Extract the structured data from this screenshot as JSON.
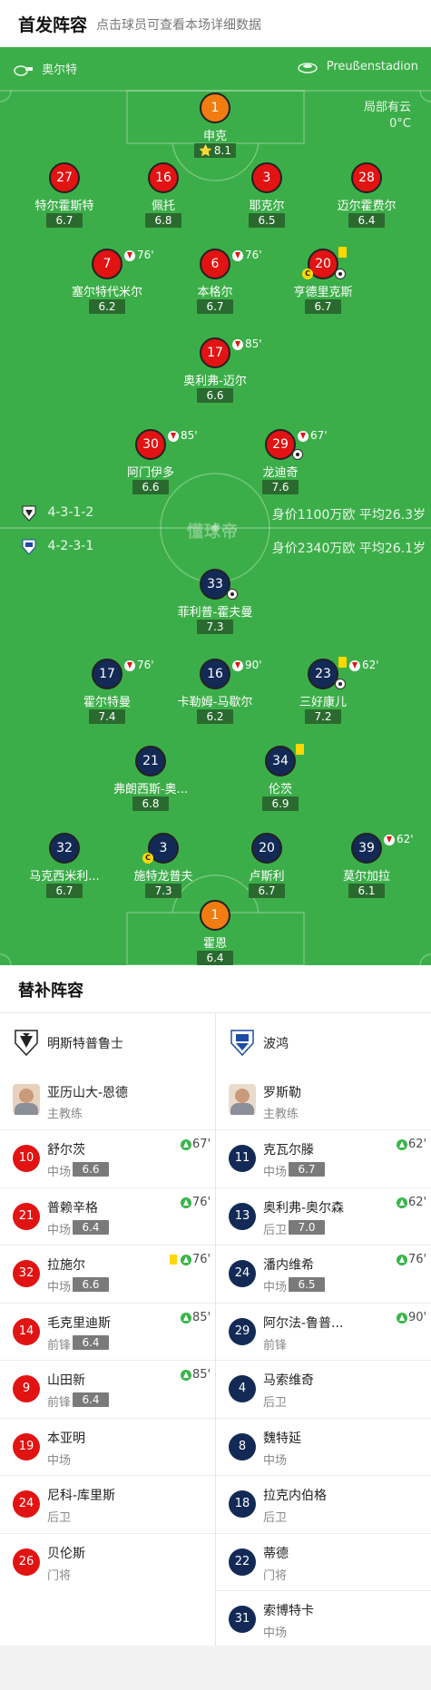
{
  "header": {
    "title": "首发阵容",
    "subtitle": "点击球员可查看本场详细数据"
  },
  "field": {
    "home_team": "奥尔特",
    "stadium": "Preußenstadion",
    "weather_line1": "局部有云",
    "weather_line2": "0°C",
    "home_formation": "4-3-1-2",
    "home_value": "身价1100万欧  平均26.3岁",
    "away_formation": "4-2-3-1",
    "away_value": "身价2340万欧  平均26.1岁",
    "watermark": "懂球帝",
    "home_players": [
      {
        "num": "1",
        "name": "申克",
        "rating": "8.1",
        "star": "⭐"
      },
      {
        "num": "27",
        "name": "特尔霍斯特",
        "rating": "6.7"
      },
      {
        "num": "16",
        "name": "佩托",
        "rating": "6.8"
      },
      {
        "num": "3",
        "name": "耶克尔",
        "rating": "6.5"
      },
      {
        "num": "28",
        "name": "迈尔霍费尔",
        "rating": "6.4"
      },
      {
        "num": "7",
        "name": "塞尔特代米尔",
        "rating": "6.2",
        "sub": "76'"
      },
      {
        "num": "6",
        "name": "本格尔",
        "rating": "6.7",
        "sub": "76'"
      },
      {
        "num": "20",
        "name": "亨德里克斯",
        "rating": "6.7",
        "cap": "C"
      },
      {
        "num": "17",
        "name": "奥利弗-迈尔",
        "rating": "6.6",
        "sub": "85'"
      },
      {
        "num": "30",
        "name": "阿门伊多",
        "rating": "6.6",
        "sub": "85'"
      },
      {
        "num": "29",
        "name": "龙迪奇",
        "rating": "7.6",
        "sub": "67'"
      }
    ],
    "away_players": [
      {
        "num": "33",
        "name": "菲利普-霍夫曼",
        "rating": "7.3"
      },
      {
        "num": "17",
        "name": "霍尔特曼",
        "rating": "7.4",
        "sub": "76'"
      },
      {
        "num": "16",
        "name": "卡勒姆-马歇尔",
        "rating": "6.2",
        "sub": "90'"
      },
      {
        "num": "23",
        "name": "三好康儿",
        "rating": "7.2",
        "sub": "62'"
      },
      {
        "num": "21",
        "name": "弗朗西斯-奥...",
        "rating": "6.8"
      },
      {
        "num": "34",
        "name": "伦茨",
        "rating": "6.9"
      },
      {
        "num": "32",
        "name": "马克西米利...",
        "rating": "6.7"
      },
      {
        "num": "3",
        "name": "施特龙普夫",
        "rating": "7.3",
        "cap": "C"
      },
      {
        "num": "20",
        "name": "卢斯利",
        "rating": "6.7"
      },
      {
        "num": "39",
        "name": "莫尔加拉",
        "rating": "6.1",
        "sub": "62'"
      },
      {
        "num": "1",
        "name": "霍恩",
        "rating": "6.4"
      }
    ]
  },
  "subs": {
    "title": "替补阵容",
    "home": {
      "club": "明斯特普鲁士",
      "coach": "亚历山大-恩德",
      "coach_role": "主教练",
      "players": [
        {
          "num": "10",
          "name": "舒尔茨",
          "pos": "中场",
          "rating": "6.6",
          "in": "67'"
        },
        {
          "num": "21",
          "name": "普赖辛格",
          "pos": "中场",
          "rating": "6.4",
          "in": "76'"
        },
        {
          "num": "32",
          "name": "拉施尔",
          "pos": "中场",
          "rating": "6.6",
          "in": "76'",
          "card": "yellow"
        },
        {
          "num": "14",
          "name": "毛克里迪斯",
          "pos": "前锋",
          "rating": "6.4",
          "in": "85'"
        },
        {
          "num": "9",
          "name": "山田新",
          "pos": "前锋",
          "rating": "6.4",
          "in": "85'"
        },
        {
          "num": "19",
          "name": "本亚明",
          "pos": "中场"
        },
        {
          "num": "24",
          "name": "尼科-库里斯",
          "pos": "后卫"
        },
        {
          "num": "26",
          "name": "贝伦斯",
          "pos": "门将"
        }
      ]
    },
    "away": {
      "club": "波鸿",
      "coach": "罗斯勒",
      "coach_role": "主教练",
      "players": [
        {
          "num": "11",
          "name": "克瓦尔滕",
          "pos": "中场",
          "rating": "6.7",
          "in": "62'"
        },
        {
          "num": "13",
          "name": "奥利弗-奥尔森",
          "pos": "后卫",
          "rating": "7.0",
          "in": "62'"
        },
        {
          "num": "24",
          "name": "潘内维希",
          "pos": "中场",
          "rating": "6.5",
          "in": "76'"
        },
        {
          "num": "29",
          "name": "阿尔法-鲁普...",
          "pos": "前锋",
          "in": "90'"
        },
        {
          "num": "4",
          "name": "马索维奇",
          "pos": "后卫"
        },
        {
          "num": "8",
          "name": "魏特延",
          "pos": "中场"
        },
        {
          "num": "18",
          "name": "拉克内伯格",
          "pos": "后卫"
        },
        {
          "num": "22",
          "name": "蒂德",
          "pos": "门将"
        },
        {
          "num": "31",
          "name": "索博特卡",
          "pos": "中场"
        }
      ]
    }
  },
  "colors": {
    "pitch": "#3cae49",
    "home": "#e11313",
    "away": "#132a56",
    "goalkeeper": "#f07c12"
  }
}
